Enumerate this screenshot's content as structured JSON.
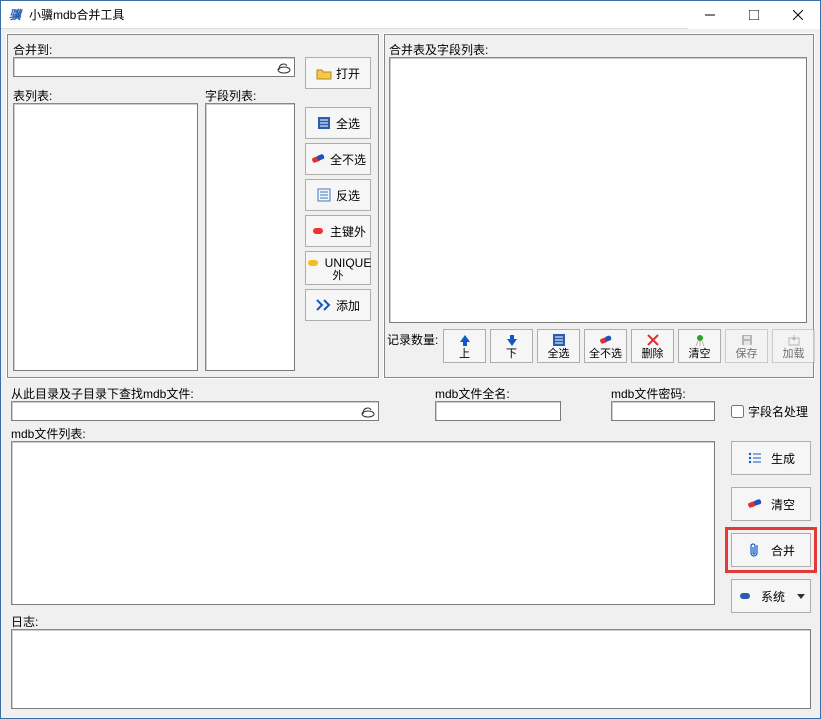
{
  "window": {
    "title": "小骥mdb合并工具"
  },
  "labels": {
    "merge_to": "合并到:",
    "table_list": "表列表:",
    "field_list": "字段列表:",
    "merge_table_fields": "合并表及字段列表:",
    "record_count": "记录数量:",
    "search_path": "从此目录及子目录下查找mdb文件:",
    "mdb_fullname": "mdb文件全名:",
    "mdb_password": "mdb文件密码:",
    "mdb_file_list": "mdb文件列表:",
    "log": "日志:",
    "fieldname_process": "字段名处理"
  },
  "buttons": {
    "open": "打开",
    "select_all": "全选",
    "select_none": "全不选",
    "invert": "反选",
    "except_pk_line1": "主键外",
    "unique_line1": "UNIQUE",
    "unique_line2": "外",
    "add": "添加",
    "up": "上",
    "down": "下",
    "all": "全选",
    "none": "全不选",
    "delete": "删除",
    "clear": "清空",
    "save": "保存",
    "load": "加载",
    "generate": "生成",
    "clear2": "清空",
    "merge": "合并",
    "system": "系统"
  },
  "inputs": {
    "merge_to": "",
    "search_path": "",
    "mdb_fullname": "",
    "mdb_password": ""
  },
  "colors": {
    "highlight": "#e53935",
    "accent_blue": "#1259c3",
    "accent_green": "#2aa02a",
    "accent_yellow": "#f0c020"
  }
}
